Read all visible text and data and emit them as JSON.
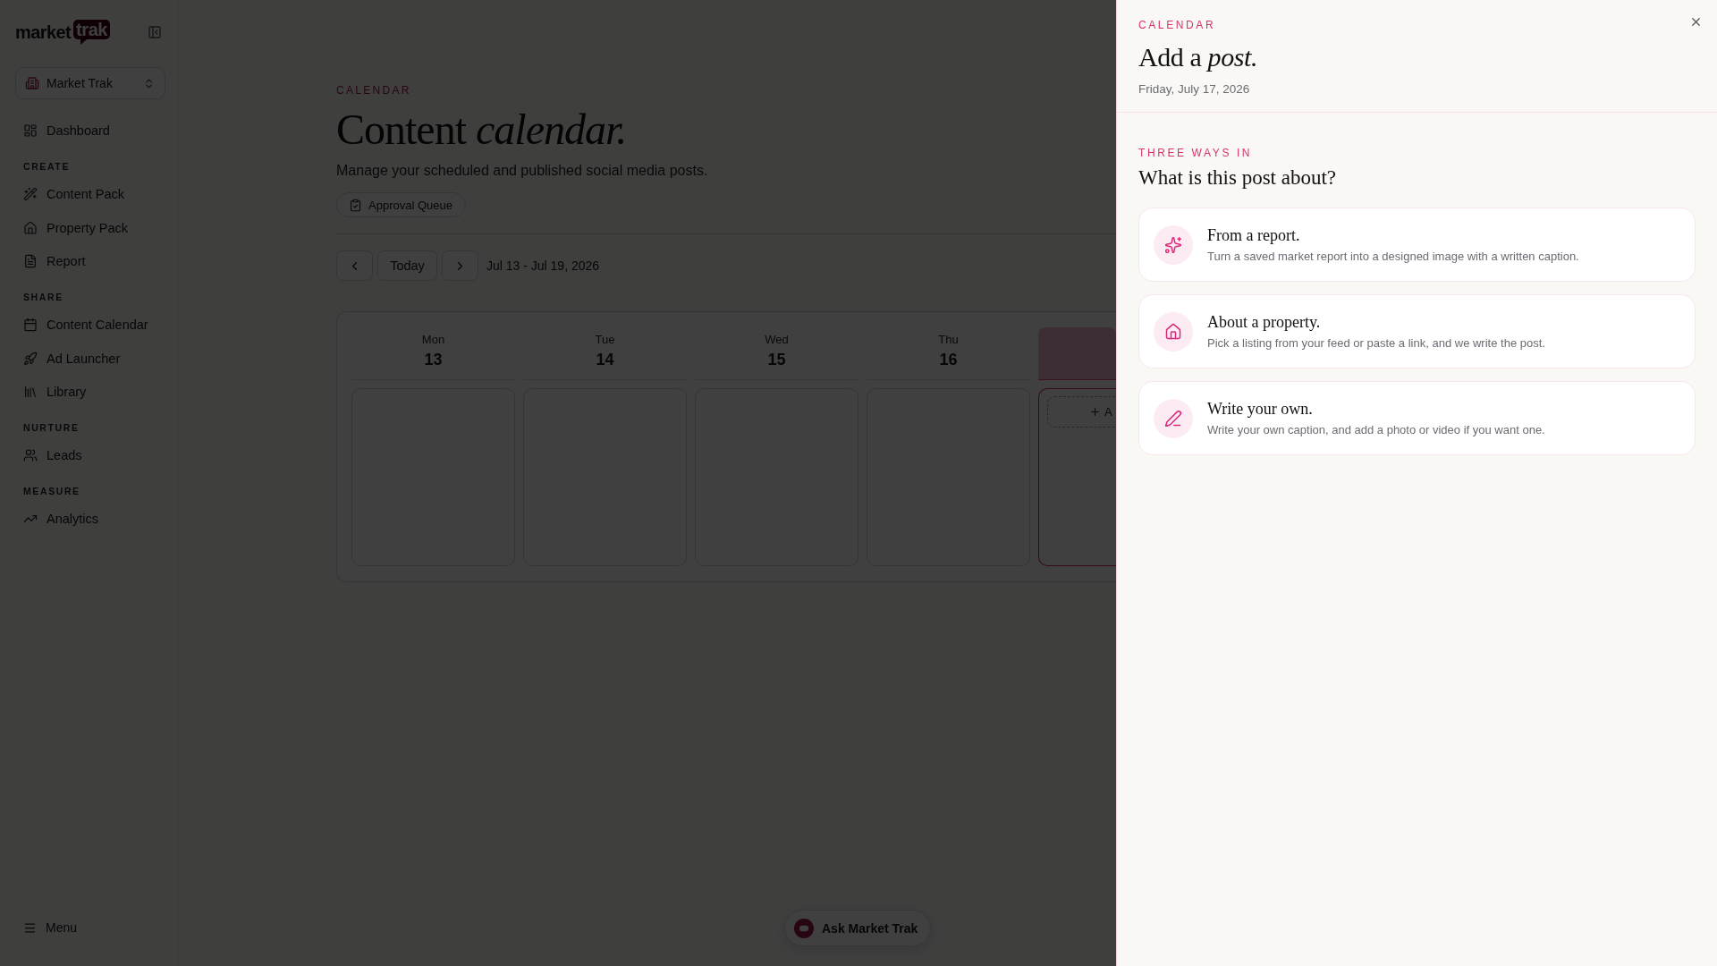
{
  "sidebar": {
    "logo": {
      "word": "market",
      "badge": "trak"
    },
    "workspace": {
      "name": "Market Trak"
    },
    "sections": [
      {
        "items": [
          {
            "label": "Dashboard"
          }
        ]
      },
      {
        "title": "CREATE",
        "items": [
          {
            "label": "Content Pack"
          },
          {
            "label": "Property Pack"
          },
          {
            "label": "Report"
          }
        ]
      },
      {
        "title": "SHARE",
        "items": [
          {
            "label": "Content Calendar"
          },
          {
            "label": "Ad Launcher"
          },
          {
            "label": "Library"
          }
        ]
      },
      {
        "title": "NURTURE",
        "items": [
          {
            "label": "Leads"
          }
        ]
      },
      {
        "title": "MEASURE",
        "items": [
          {
            "label": "Analytics"
          }
        ]
      }
    ],
    "menu": "Menu"
  },
  "main": {
    "eyebrow": "CALENDAR",
    "title": "Content *calendar.*",
    "subtitle": "Manage your scheduled and published social media posts.",
    "approval_button": "Approval Queue",
    "week_nav": {
      "today": "Today",
      "range": "Jul 13 - Jul 19, 2026"
    },
    "calendar": {
      "days": [
        {
          "day": "Mon",
          "date": "13",
          "selected": false
        },
        {
          "day": "Tue",
          "date": "14",
          "selected": false
        },
        {
          "day": "Wed",
          "date": "15",
          "selected": false
        },
        {
          "day": "Thu",
          "date": "16",
          "selected": false
        },
        {
          "selected": true,
          "add_label": "A"
        }
      ]
    }
  },
  "assistant_button": "Ask Market Trak",
  "panel": {
    "eyebrow": "CALENDAR",
    "title": "Add a *post.*",
    "date": "Friday, July 17, 2026",
    "section_label": "THREE WAYS IN",
    "question": "What is this post about?",
    "options": [
      {
        "title": "From a report.",
        "description": "Turn a saved market report into a designed image with a written caption."
      },
      {
        "title": "About a property.",
        "description": "Pick a listing from your feed or paste a link, and we write the post."
      },
      {
        "title": "Write your own.",
        "description": "Write your own caption, and add a photo or video if you want one."
      }
    ]
  }
}
